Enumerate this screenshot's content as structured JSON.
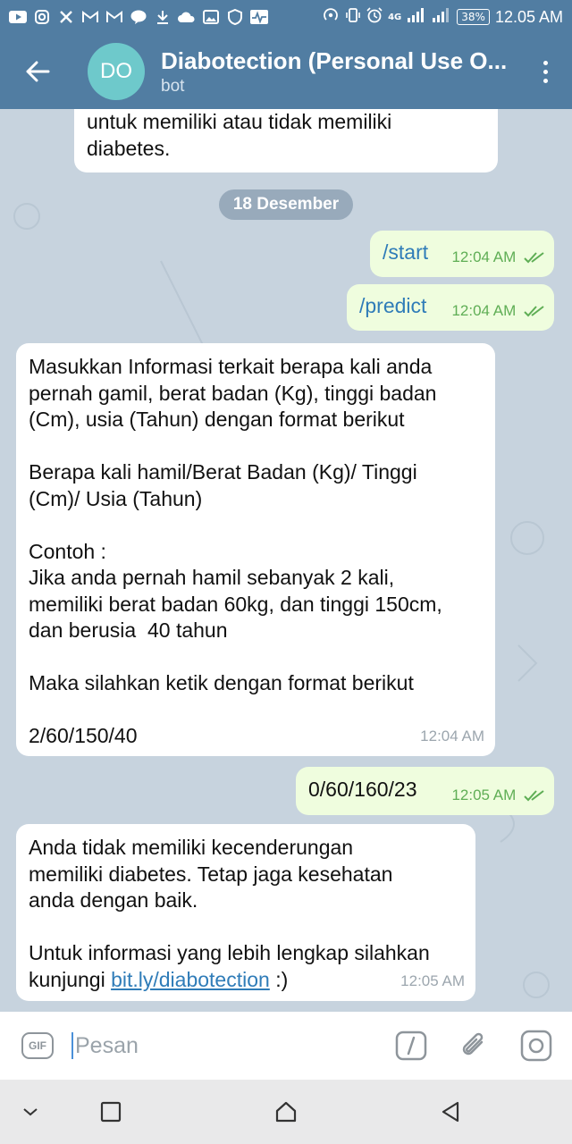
{
  "status_bar": {
    "left_icons": [
      "youtube-icon",
      "instagram-icon",
      "x-icon",
      "gmail-icon",
      "gmail-icon",
      "line-icon",
      "download-icon",
      "cloud-icon",
      "gallery-icon",
      "shield-icon",
      "pulse-icon"
    ],
    "network": "4G",
    "battery": "38%",
    "time": "12.05 AM"
  },
  "header": {
    "avatar_initials": "DO",
    "avatar_color": "#6ec9cb",
    "title": "Diabotection (Personal Use O...",
    "subtitle": "bot"
  },
  "messages": {
    "m0": {
      "text": "untuk memiliki atau tidak memiliki\ndiabetes."
    },
    "date_separator": "18 Desember",
    "m1": {
      "text": "/start",
      "time": "12:04 AM"
    },
    "m2": {
      "text": "/predict",
      "time": "12:04 AM"
    },
    "m3": {
      "text": "Masukkan Informasi terkait berapa kali anda\npernah gamil, berat badan (Kg), tinggi badan\n(Cm), usia (Tahun) dengan format berikut\n\nBerapa kali hamil/Berat Badan (Kg)/ Tinggi\n(Cm)/ Usia (Tahun)\n\nContoh :\nJika anda pernah hamil sebanyak 2 kali,\nmemiliki berat badan 60kg, dan tinggi 150cm,\ndan berusia  40 tahun\n\nMaka silahkan ketik dengan format berikut\n\n2/60/150/40",
      "time": "12:04 AM"
    },
    "m4": {
      "text": "0/60/160/23",
      "time": "12:05 AM"
    },
    "m5": {
      "text": "Anda tidak memiliki kecenderungan\nmemiliki diabetes. Tetap jaga kesehatan\nanda dengan baik.\n\nUntuk informasi yang lebih lengkap silahkan\nkunjungi ",
      "link": "bit.ly/diabotection",
      "suffix": " :)",
      "time": "12:05 AM"
    }
  },
  "composer": {
    "gif_label": "GIF",
    "placeholder": "Pesan"
  },
  "colors": {
    "header_bg": "#517da2",
    "chat_bg": "#c7d3de",
    "outgoing_bubble": "#effdde",
    "incoming_bubble": "#ffffff",
    "link": "#2f7cb8",
    "outgoing_time": "#5fae55"
  }
}
